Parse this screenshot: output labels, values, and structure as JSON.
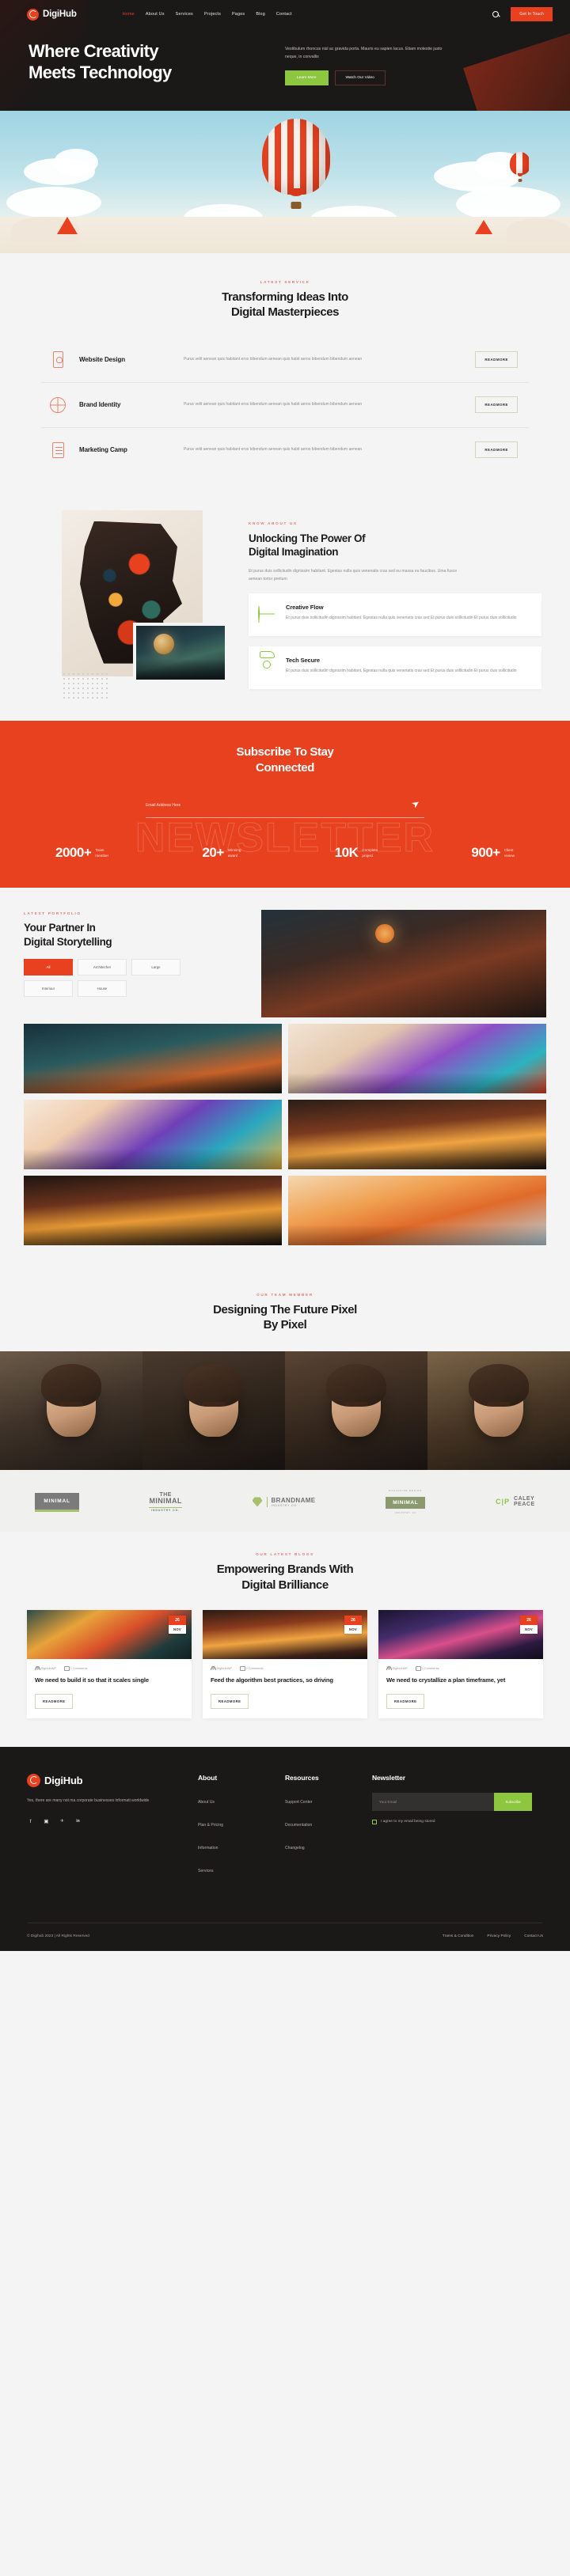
{
  "brand": {
    "name": "DigiHub"
  },
  "nav": {
    "links": [
      {
        "label": "Home",
        "active": true
      },
      {
        "label": "About Us",
        "active": false
      },
      {
        "label": "Services",
        "active": false
      },
      {
        "label": "Projects",
        "active": false
      },
      {
        "label": "Pages",
        "active": false
      },
      {
        "label": "Blog",
        "active": false
      },
      {
        "label": "Contact",
        "active": false
      }
    ],
    "search_icon": "search-icon",
    "cta_label": "Get In Touch"
  },
  "hero": {
    "title_line1": "Where Creativity",
    "title_line2": "Meets Technology",
    "description": "Vestibulum rhoncus nisl ac gravida porta. Mauris eu sapien lacus. Etiam molestie justo neque, in convallis",
    "primary_btn": "Learn More",
    "secondary_btn": "Watch Our Video"
  },
  "services": {
    "eyebrow": "LATEST SERVICE",
    "title_line1": "Transforming Ideas Into",
    "title_line2": "Digital Masterpieces",
    "read_more": "READMORE",
    "items": [
      {
        "icon": "mobile-design-icon",
        "name": "Website Design",
        "desc": "Purus velit aenean quis habitant eros bibendum aenean quis habit aeros bibendum bibendum aenean"
      },
      {
        "icon": "globe-identity-icon",
        "name": "Brand Identity",
        "desc": "Purus velit aenean quis habitant eros bibendum aenean quis habit aeros bibendum bibendum aenean"
      },
      {
        "icon": "document-marketing-icon",
        "name": "Marketing Camp",
        "desc": "Purus velit aenean quis habitant eros bibendum aenean quis habit aeros bibendum bibendum aenean"
      }
    ]
  },
  "about": {
    "eyebrow": "KNOW ABOUT US",
    "title_line1": "Unlocking The Power Of",
    "title_line2": "Digital Imagination",
    "description": "Et purus duis sollicitudin dignissim habitant. Egestas nulla quis venenatis cras sed eu massa eu faucibus. Uma fusce aenean tortor pretium",
    "features": [
      {
        "icon": "globe-search-icon",
        "title": "Creative Flow",
        "desc": "Et purus duis sollicitudin dignissim habitant. Egestas nulla quis venenatis cras sed Et purus duis sollicitudin Et purus duis sollicitudin"
      },
      {
        "icon": "hand-shield-icon",
        "title": "Tech Secure",
        "desc": "Et purus duis sollicitudin dignissim habitant. Egestas nulla quis venenatis cras sed Et purus duis sollicitudin Et purus duis sollicitudin"
      }
    ]
  },
  "newsletter": {
    "ghost_text": "NEWSLETTER",
    "title_line1": "Subscribe To Stay",
    "title_line2": "Connected",
    "email_placeholder": "Email Address Here",
    "send_icon": "paper-plane-icon",
    "accent_color": "#e8411f",
    "stats": [
      {
        "number": "2000+",
        "label_line1": "Team",
        "label_line2": "member"
      },
      {
        "number": "20+",
        "label_line1": "Winning",
        "label_line2": "award"
      },
      {
        "number": "10K",
        "label_line1": "Complete",
        "label_line2": "project"
      },
      {
        "number": "900+",
        "label_line1": "Client",
        "label_line2": "review"
      }
    ]
  },
  "portfolio": {
    "eyebrow": "LATEST PORTFOLIO",
    "title_line1": "Your Partner In",
    "title_line2": "Digital Storytelling",
    "filters": [
      {
        "label": "All",
        "active": true
      },
      {
        "label": "Architecher",
        "active": false
      },
      {
        "label": "Large",
        "active": false
      },
      {
        "label": "Interiour",
        "active": false
      },
      {
        "label": "House",
        "active": false
      }
    ],
    "items": [
      {
        "name": "portfolio-item-1"
      },
      {
        "name": "portfolio-item-2"
      },
      {
        "name": "portfolio-item-3"
      },
      {
        "name": "portfolio-item-4"
      },
      {
        "name": "portfolio-item-5"
      },
      {
        "name": "portfolio-item-6"
      },
      {
        "name": "portfolio-item-7"
      }
    ]
  },
  "team": {
    "eyebrow": "OUR TEAM MEMBER",
    "title_line1": "Designing The Future Pixel",
    "title_line2": "By Pixel",
    "members": [
      {
        "name": "team-member-1"
      },
      {
        "name": "team-member-2"
      },
      {
        "name": "team-member-3"
      },
      {
        "name": "team-member-4"
      }
    ]
  },
  "clients": {
    "logos": [
      {
        "id": "minimal-box-logo",
        "text": "MINIMAL"
      },
      {
        "id": "the-minimal-logo",
        "line1": "THE",
        "line2": "MINIMAL",
        "line3": "INDUSTRY CO."
      },
      {
        "id": "brandname-logo",
        "line1": "BRANDNAME",
        "line2": "INDUSTRY CO."
      },
      {
        "id": "exclusive-minimal-logo",
        "top": "EXCLUSIVE DESIGN",
        "mid": "MINIMAL",
        "bot": "INDUSTRY CO"
      },
      {
        "id": "caley-peace-logo",
        "mark": "C|P",
        "line1": "CALEY",
        "line2": "PEACE"
      }
    ]
  },
  "blog": {
    "eyebrow": "OUR LATEST BLOGS",
    "title_line1": "Empowering Brands With",
    "title_line2": "Digital Brilliance",
    "read_more": "READMORE",
    "posts": [
      {
        "day": "26",
        "month": "NOV",
        "author": "DigihubWP",
        "comments": "2 Comments",
        "title": "We need to build it so that it scales single"
      },
      {
        "day": "26",
        "month": "NOV",
        "author": "DigihubWP",
        "comments": "2 Comments",
        "title": "Feed the algorithm best practices, so driving"
      },
      {
        "day": "26",
        "month": "NOV",
        "author": "DigihubWP",
        "comments": "2 Comments",
        "title": "We need to crystallize a plan timeframe, yet"
      }
    ]
  },
  "footer": {
    "brand_name": "DigiHub",
    "description": "Yes, there are many not ma corporate businesses informati worldwide",
    "socials": [
      {
        "icon": "facebook-icon",
        "glyph": "f"
      },
      {
        "icon": "instagram-icon",
        "glyph": "▣"
      },
      {
        "icon": "twitter-icon",
        "glyph": "🐦"
      },
      {
        "icon": "linkedin-icon",
        "glyph": "in"
      }
    ],
    "about": {
      "title": "About",
      "links": [
        "About Us",
        "Plan & Pricing",
        "Information",
        "Services"
      ]
    },
    "resources": {
      "title": "Resources",
      "links": [
        "Support Center",
        "Documentation",
        "Changelog"
      ]
    },
    "newsletter": {
      "title": "Newsletter",
      "placeholder": "Your Email",
      "subscribe_label": "Subscribe",
      "agree_label": "I agree to my email being stored"
    },
    "copyright": "© Digihub 2023 | All Rights Reserved",
    "bottom_links": [
      "Trams & Condition",
      "Privacy Policy",
      "Contact Us"
    ]
  }
}
